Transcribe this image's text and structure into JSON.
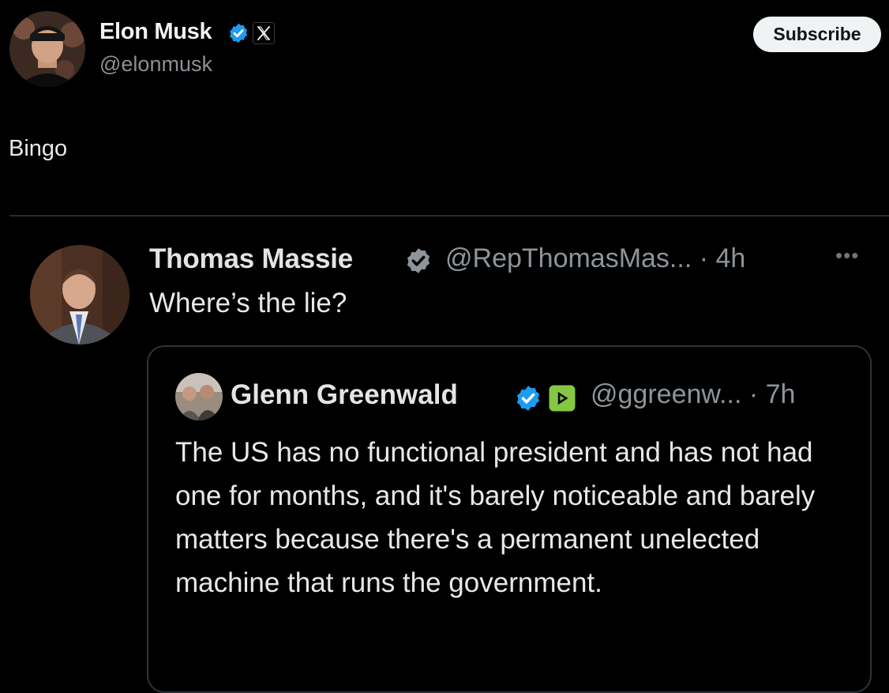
{
  "post": {
    "author_name": "Elon Musk",
    "author_handle": "@elonmusk",
    "author_verified_icon": "verified-badge-icon",
    "author_affiliate_icon": "x-logo-icon",
    "subscribe_label": "Subscribe",
    "text": "Bingo"
  },
  "quoted_post": {
    "author_name": "Thomas Massie",
    "author_meta": "@RepThomasMas... · 4h",
    "author_verified_icon": "verified-badge-icon",
    "more_icon": "more-options-icon",
    "more_glyph": "•••",
    "text": "Where’s the lie?",
    "embedded_quote": {
      "author_name": "Glenn Greenwald",
      "author_meta": "@ggreenw... · 7h",
      "author_verified_icon": "verified-badge-icon",
      "affiliate_icon": "rumble-icon",
      "text": "The US has no functional president and has not had one for months, and it's barely noticeable and barely matters because there's a permanent unelected machine that runs the government."
    }
  },
  "colors": {
    "background": "#000000",
    "verified_blue": "#1d9bf0",
    "rumble_green": "#85c742",
    "muted_text": "#8b9096",
    "divider": "#2a2d31"
  }
}
